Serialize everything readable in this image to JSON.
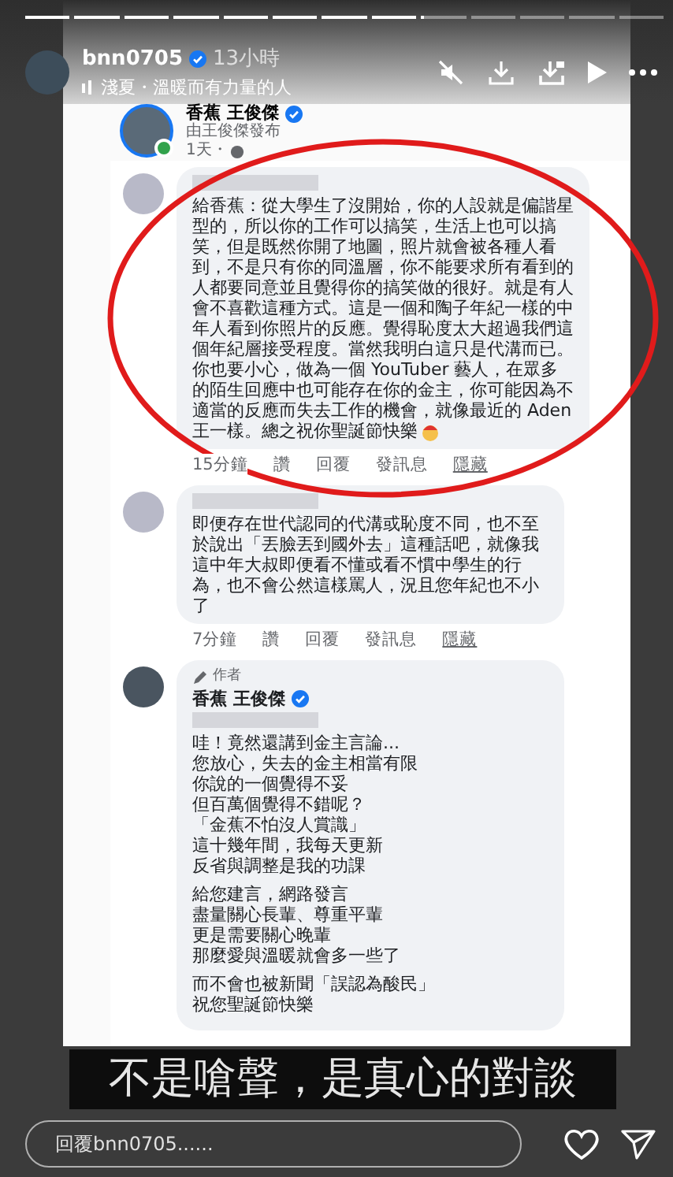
{
  "story": {
    "segments": [
      {
        "level": 1
      },
      {
        "level": 1
      },
      {
        "level": 1
      },
      {
        "level": 1
      },
      {
        "level": 1
      },
      {
        "level": 1
      },
      {
        "level": 1
      },
      {
        "level": 1
      },
      {
        "level": 0.05
      }
    ],
    "username": "bnn0705",
    "time": "13小時",
    "music": "淺夏・溫暖而有力量的人"
  },
  "post": {
    "author": "香蕉 王俊傑",
    "byline": "由王俊傑發布",
    "time": "1天・"
  },
  "comments": [
    {
      "kind": "reply",
      "text": "給香蕉：從大學生了沒開始，你的人設就是偏諧星型的，所以你的工作可以搞笑，生活上也可以搞笑，但是既然你開了地圖，照片就會被各種人看到，不是只有你的同溫層，你不能要求所有看到的人都要同意並且覺得你的搞笑做的很好。就是有人會不喜歡這種方式。這是一個和陶子年紀一樣的中年人看到你照片的反應。覺得恥度太大超過我們這個年紀層接受程度。當然我明白這只是代溝而已。你也要小心，做為一個 YouTuber 藝人，在眾多的陌生回應中也可能存在你的金主，你可能因為不適當的反應而失去工作的機會，就像最近的 Aden 王一樣。總之祝你聖誕節快樂",
      "emoji": true,
      "time": "15分鐘",
      "actions": [
        "讚",
        "回覆",
        "發訊息",
        "隱藏"
      ]
    },
    {
      "kind": "reply",
      "text": "即便存在世代認同的代溝或恥度不同，也不至於說出「丟臉丟到國外去」這種話吧，就像我這中年大叔即便看不懂或看不慣中學生的行為，也不會公然這樣罵人，況且您年紀也不小了",
      "emoji": false,
      "time": "7分鐘",
      "actions": [
        "讚",
        "回覆",
        "發訊息",
        "隱藏"
      ]
    },
    {
      "kind": "author",
      "badge": "作者",
      "author": "香蕉 王俊傑",
      "paragraphs": [
        [
          "哇！竟然還講到金主言論...",
          "您放心，失去的金主相當有限",
          "你說的一個覺得不妥",
          "但百萬個覺得不錯呢？",
          "「金蕉不怕沒人賞識」",
          "這十幾年間，我每天更新",
          "反省與調整是我的功課"
        ],
        [
          "給您建言，網路發言",
          "盡量關心長輩、尊重平輩",
          "更是需要關心晚輩",
          "那麼愛與溫暖就會多一些了"
        ],
        [
          "而不會也被新聞「誤認為酸民」",
          "祝您聖誕節快樂"
        ]
      ]
    }
  ],
  "caption": "不是嗆聲，是真心的對談",
  "reply_field": {
    "placeholder": "回覆bnn0705......"
  }
}
